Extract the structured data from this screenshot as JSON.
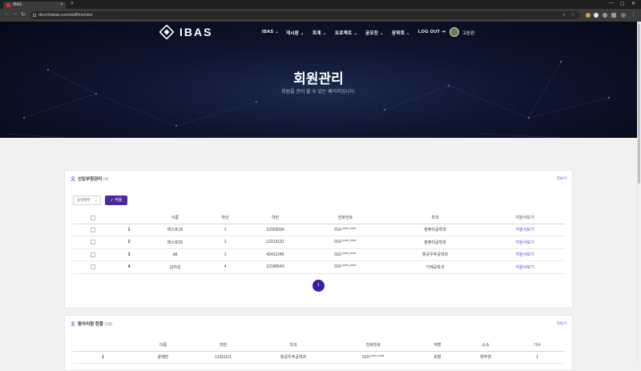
{
  "browser": {
    "tab_title": "IBAS",
    "new_tab": "+",
    "url": "dev.inhabas.com/staff/member",
    "window_controls": [
      "—",
      "▢",
      "✕"
    ]
  },
  "nav": {
    "brand": "IBAS",
    "menu": [
      "IBAS ⌄",
      "게시판 ⌄",
      "회계 ⌄",
      "프로젝트 ⌄",
      "공모전 ⌄",
      "장학회 ⌄",
      "LOG OUT ⇥"
    ],
    "user": "고승완"
  },
  "hero": {
    "title": "회원관리",
    "subtitle": "회원을 관리 할 수 있는 페이지입니다."
  },
  "new_members": {
    "title": "신입부원관리",
    "count": "(4)",
    "more": "더보기",
    "filter_select": "승인여부",
    "apply_label": "적용",
    "columns": [
      "",
      "",
      "이름",
      "학년",
      "학번",
      "전화번호",
      "학과",
      "지원서보기"
    ],
    "rows": [
      {
        "no": "1",
        "name": "테스트19",
        "grade": "1",
        "sid": "12303030",
        "phone": "010-****-****",
        "dept": "컴퓨터공학과",
        "link": "지원서보기"
      },
      {
        "no": "2",
        "name": "테스트20",
        "grade": "1",
        "sid": "12313131",
        "phone": "010-****-****",
        "dept": "컴퓨터공학과",
        "link": "지원서보기"
      },
      {
        "no": "3",
        "name": "dd",
        "grade": "1",
        "sid": "42411245",
        "phone": "010-****-****",
        "dept": "항공우주공학과",
        "link": "지원서보기"
      },
      {
        "no": "4",
        "name": "김지성",
        "grade": "4",
        "sid": "12180543",
        "phone": "010-****-****",
        "dept": "기계공학과",
        "link": "지원서보기"
      }
    ],
    "page": "1"
  },
  "club_members": {
    "title": "동아리원 현황",
    "count": "(18)",
    "more": "더보기",
    "columns": [
      "",
      "이름",
      "학번",
      "학과",
      "전화번호",
      "역할",
      "소속",
      "기수"
    ],
    "rows": [
      {
        "no": "1",
        "name": "윤예진",
        "sid": "12111111",
        "dept": "항공우주공학과",
        "phone": "010-****-****",
        "role": "회장",
        "affil": "학부생",
        "gen": "1"
      }
    ]
  },
  "colors": {
    "accent": "#4a2b9e",
    "link": "#5b36c6",
    "hero_dark": "#060916"
  }
}
